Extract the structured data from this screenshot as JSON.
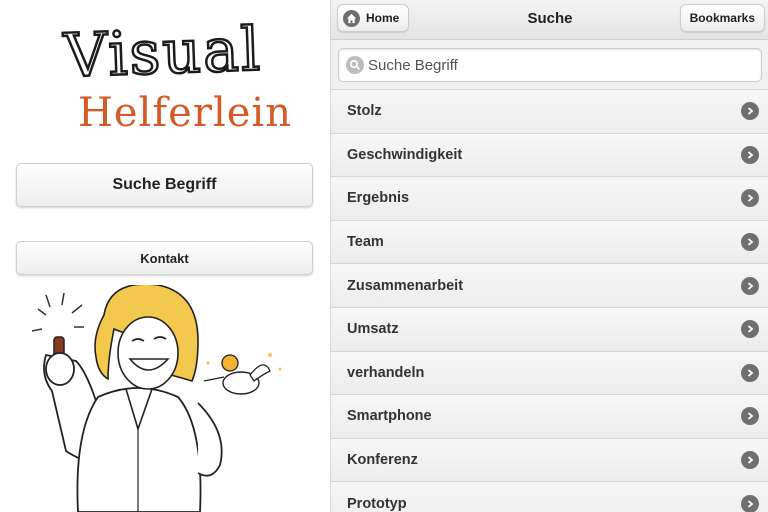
{
  "logo": {
    "line1": "Visual",
    "line2": "Helferlein"
  },
  "left": {
    "search_button": "Suche Begriff",
    "contact_button": "Kontakt"
  },
  "header": {
    "title": "Suche",
    "home_label": "Home",
    "bookmarks_label": "Bookmarks"
  },
  "search": {
    "placeholder": "Suche Begriff",
    "value": ""
  },
  "list": {
    "items": [
      {
        "label": "Stolz"
      },
      {
        "label": "Geschwindigkeit"
      },
      {
        "label": "Ergebnis"
      },
      {
        "label": "Team"
      },
      {
        "label": "Zusammenarbeit"
      },
      {
        "label": "Umsatz"
      },
      {
        "label": "verhandeln"
      },
      {
        "label": "Smartphone"
      },
      {
        "label": "Konferenz"
      },
      {
        "label": "Prototyp"
      }
    ]
  },
  "icons": {
    "home": "home-icon",
    "search": "search-icon",
    "list_arrow": "chevron-right-icon"
  },
  "colors": {
    "logo_accent": "#d45a27",
    "hair": "#f2c94c",
    "icon_gray": "#6f6f6f"
  }
}
